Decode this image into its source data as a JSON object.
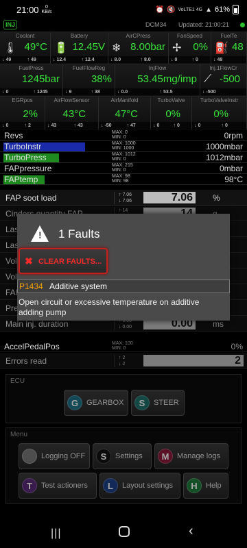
{
  "status": {
    "time": "21:00",
    "net_speed_value": "0",
    "net_speed_unit": "KB/s",
    "network": "VoLTE1 4G",
    "battery": "61%"
  },
  "app": {
    "badge": "INJ",
    "module": "DCM34",
    "updated": "Updated: 21:00:21"
  },
  "gauges_row1": [
    {
      "title": "Coolant",
      "value": "49°C",
      "icon": "coolant-icon",
      "min": "49",
      "max": "49"
    },
    {
      "title": "Battery",
      "value": "12.45V",
      "icon": "battery-icon",
      "min": "12.4",
      "max": "12.4"
    },
    {
      "title": "AirCPress",
      "value": "8.00bar",
      "icon": "snowflake-icon",
      "min": "8.0",
      "max": "8.0"
    },
    {
      "title": "FanSpeed",
      "value": "0%",
      "icon": "fan-icon",
      "min": "0",
      "max": "0"
    },
    {
      "title": "FuelTe",
      "value": "48",
      "icon": "fuel-pump-icon",
      "min": "48",
      "max": ""
    }
  ],
  "gauges_row2": [
    {
      "title": "FuelPress",
      "value": "1245bar",
      "min": "0",
      "max": "1245"
    },
    {
      "title": "FuelFlowReg",
      "value": "38%",
      "min": "9",
      "max": "38"
    },
    {
      "title": "InjFlow",
      "value": "53.45mg/imp",
      "icon": "injector-icon",
      "min": "0.0",
      "max": "53.5"
    },
    {
      "title": "Inj.1FlowCr",
      "value": "-500",
      "min": "-500",
      "max": ""
    }
  ],
  "gauges_row3": [
    {
      "title": "EGRpos",
      "value": "2%",
      "min": "0",
      "max": "2"
    },
    {
      "title": "AirFlowSensor",
      "value": "43°C",
      "min": "43",
      "max": "43"
    },
    {
      "title": "AirManifold",
      "value": "47°C",
      "min": "-50",
      "max": "47"
    },
    {
      "title": "TurboValve",
      "value": "0%",
      "min": "0",
      "max": "0"
    },
    {
      "title": "TurboValveInstr",
      "value": "0%",
      "min": "0",
      "max": "0"
    }
  ],
  "bar_rows": [
    {
      "label": "Revs",
      "max": "MAX: 0",
      "min": "MIN: 0",
      "value": "0rpm",
      "bar_color": "",
      "fill": 0
    },
    {
      "label": "TurboInstr",
      "max": "MAX: 1000",
      "min": "MIN: 1000",
      "value": "1000mbar",
      "bar_color": "#1a2aa8",
      "fill": 0.34
    },
    {
      "label": "TurboPress",
      "max": "MAX: 1012",
      "min": "MIN: 0",
      "value": "1012mbar",
      "bar_color": "#1f8a1f",
      "fill": 0.23
    },
    {
      "label": "FAPpressure",
      "max": "MAX: 215",
      "min": "MIN: 0",
      "value": "0mbar",
      "bar_color": "",
      "fill": 0
    },
    {
      "label": "FAPtemp",
      "max": "MAX: 98",
      "min": "MIN: 98",
      "value": "98°C",
      "bar_color": "#1f8a1f",
      "fill": 0.17
    }
  ],
  "value_rows": [
    {
      "label": "FAP soot load",
      "max": "7.06",
      "min": "7.06",
      "value": "7.06",
      "unit": "%"
    },
    {
      "label": "Cinders quantity FAP",
      "max": "14",
      "min": "",
      "value": "14",
      "unit": "g"
    },
    {
      "label": "Las",
      "max": "",
      "min": "",
      "value": "",
      "unit": ""
    },
    {
      "label": "Las",
      "max": "",
      "min": "",
      "value": "",
      "unit": ""
    },
    {
      "label": "Vol",
      "max": "",
      "min": "",
      "value": "",
      "unit": ""
    },
    {
      "label": "Vol",
      "max": "",
      "min": "",
      "value": "",
      "unit": ""
    },
    {
      "label": "FAP",
      "max": "",
      "min": "",
      "value": "",
      "unit": ""
    },
    {
      "label": "Pre",
      "max": "",
      "min": "",
      "value": "",
      "unit": ""
    },
    {
      "label": "Main inj. duration",
      "max": "0.00",
      "min": "0.00",
      "value": "0.00",
      "unit": "ms"
    }
  ],
  "accel": {
    "label": "AccelPedalPos",
    "max": "MAX: 100",
    "min": "MIN: 0",
    "value": "0%"
  },
  "errors": {
    "label": "Errors read",
    "max": "2",
    "min": "2",
    "value": "2"
  },
  "dialog": {
    "title": "1 Faults",
    "clear_label": "CLEAR FAULTS...",
    "fault_code": "P1434",
    "fault_name": "Additive system",
    "fault_desc": "Open circuit or excessive temperature on additive adding pump"
  },
  "ecu": {
    "title": "ECU",
    "buttons": [
      {
        "letter": "G",
        "label": "GEARBOX",
        "color": "#1e6f86"
      },
      {
        "letter": "S",
        "label": "STEER",
        "color": "#1e6f6a"
      }
    ]
  },
  "menu": {
    "title": "Menu",
    "buttons": [
      {
        "letter": "",
        "label": "Logging OFF",
        "color": "#777777"
      },
      {
        "letter": "S",
        "label": "Settings",
        "color": "#111111"
      },
      {
        "letter": "M",
        "label": "Manage logs",
        "color": "#8a1a3a"
      },
      {
        "letter": "T",
        "label": "Test actioners",
        "color": "#5a2a78"
      },
      {
        "letter": "L",
        "label": "Layout settings",
        "color": "#1e3f86"
      },
      {
        "letter": "H",
        "label": "Help",
        "color": "#1e7a3a"
      }
    ]
  }
}
